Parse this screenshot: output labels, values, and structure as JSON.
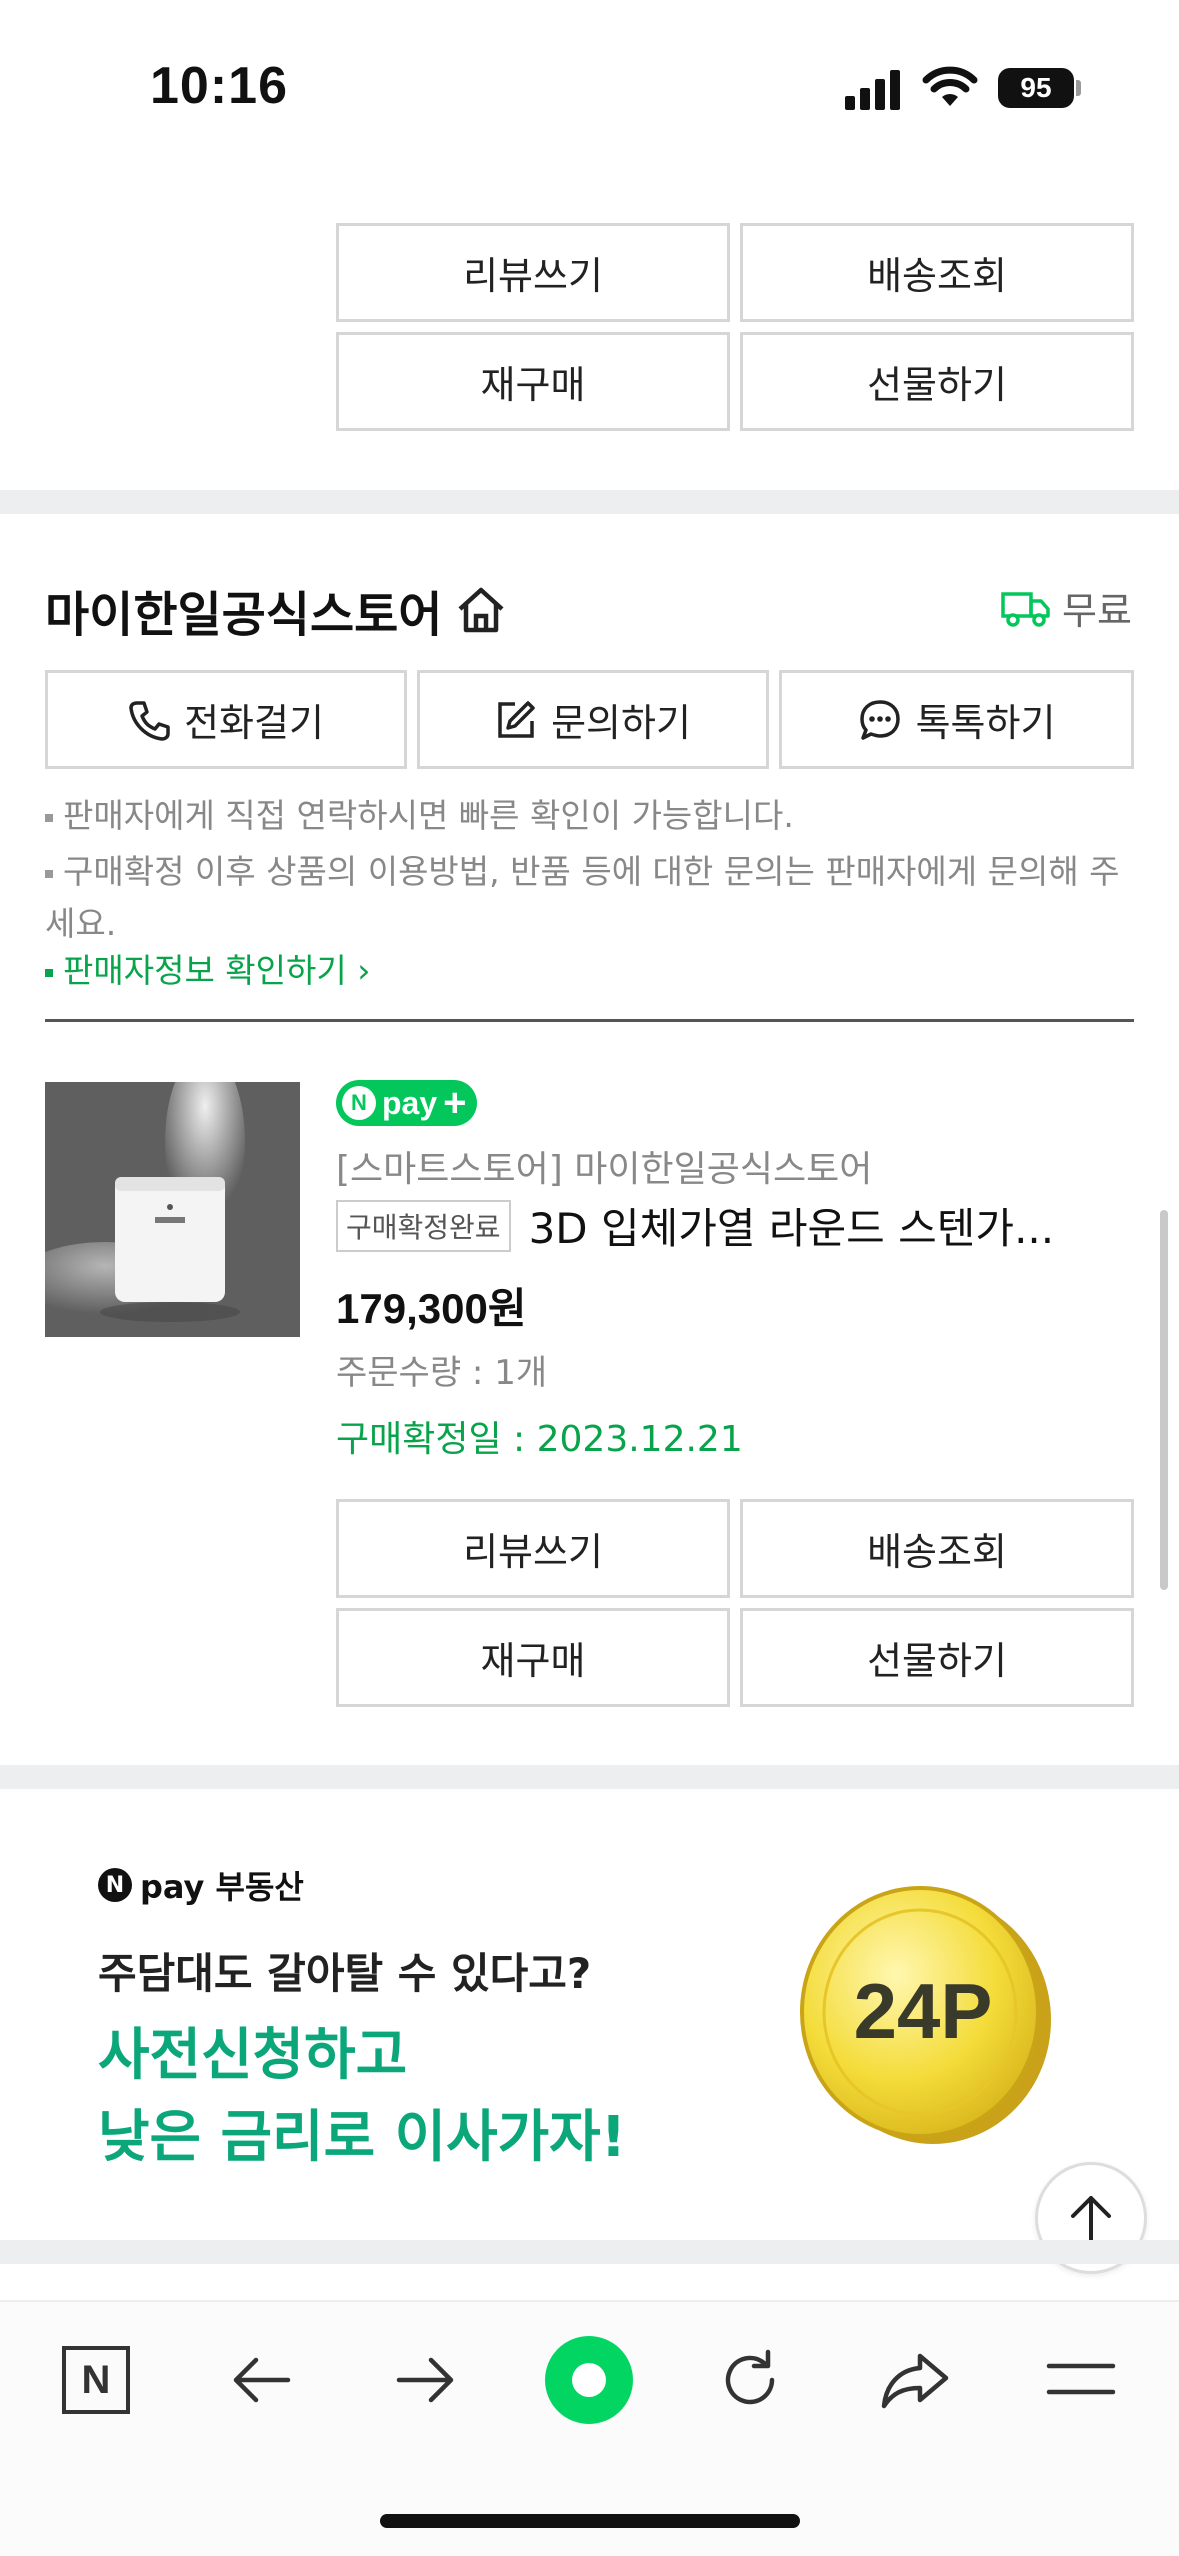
{
  "status_bar": {
    "time": "10:16",
    "battery": "95"
  },
  "prev_order_actions": {
    "review": "리뷰쓰기",
    "tracking": "배송조회",
    "rebuy": "재구매",
    "gift": "선물하기"
  },
  "store": {
    "name": "마이한일공식스토어",
    "shipping": "무료",
    "contact_buttons": {
      "call": "전화걸기",
      "inquiry": "문의하기",
      "talk": "톡톡하기"
    },
    "notes": [
      "판매자에게 직접 연락하시면 빠른 확인이 가능합니다.",
      "구매확정 이후 상품의 이용방법, 반품 등에 대한 문의는 판매자에게 문의해 주세요."
    ],
    "seller_info_link": "판매자정보 확인하기"
  },
  "order": {
    "badge": "pay",
    "seller": "[스마트스토어] 마이한일공식스토어",
    "status_tag": "구매확정완료",
    "product_name": "3D 입체가열 라운드 스텐가...",
    "price": "179,300원",
    "quantity": "주문수량 : 1개",
    "confirm_date": "구매확정일 : 2023.12.21",
    "actions": {
      "review": "리뷰쓰기",
      "tracking": "배송조회",
      "rebuy": "재구매",
      "gift": "선물하기"
    }
  },
  "banner": {
    "brand": "pay 부동산",
    "subtitle": "주담대도 갈아탈 수 있다고?",
    "headline_1": "사전신청하고",
    "headline_2": "낮은 금리로 이사가자!",
    "coin_text": "24P"
  },
  "colors": {
    "accent": "#03c75a",
    "banner_green": "#0ba67a",
    "separator": "#eceeef"
  }
}
